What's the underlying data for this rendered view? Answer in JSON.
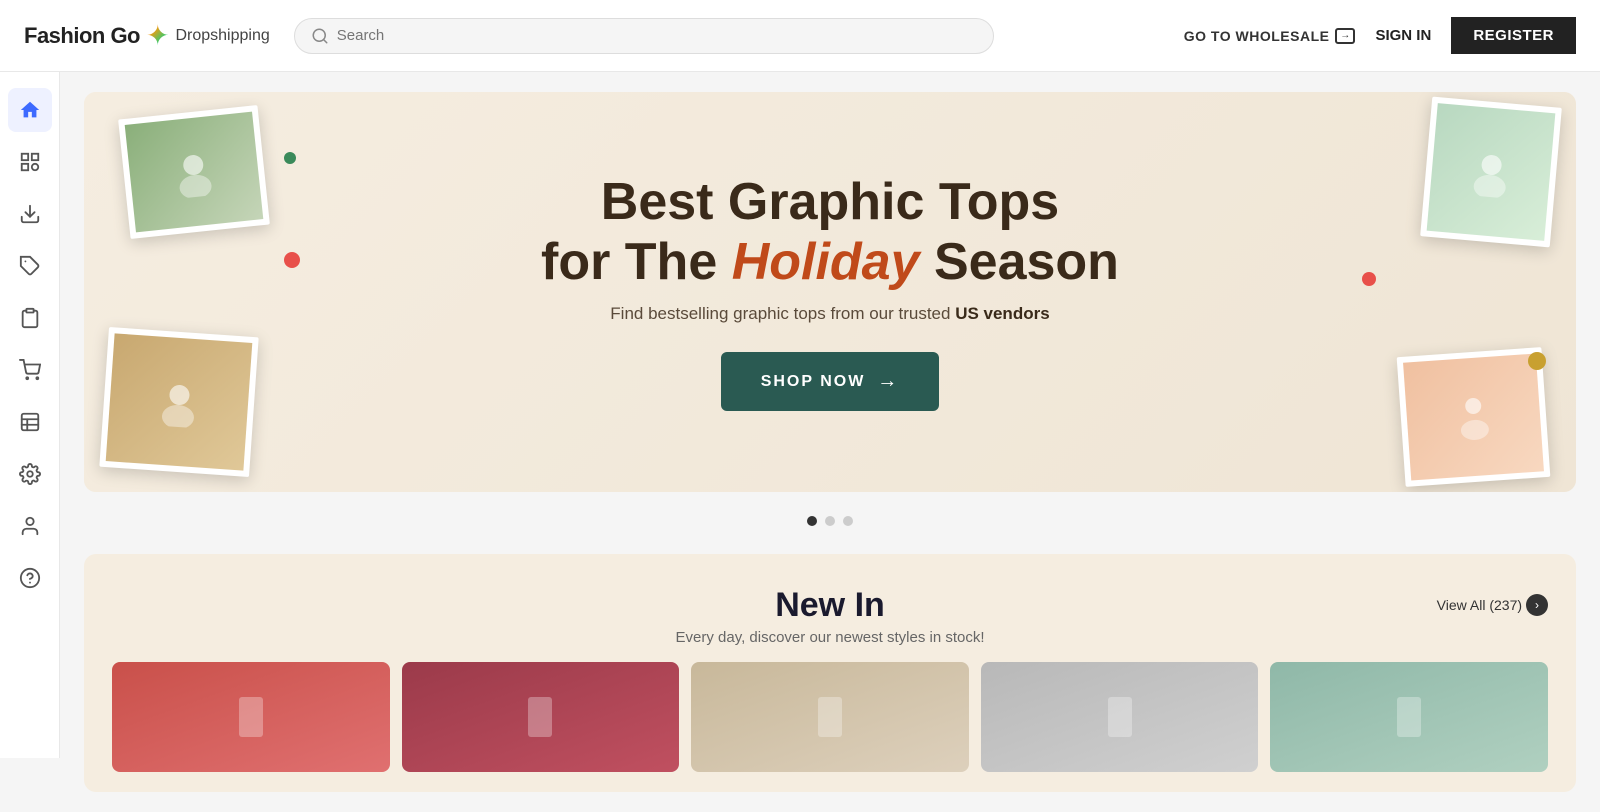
{
  "header": {
    "logo_brand": "Fashion Go",
    "logo_star_symbol": "✦",
    "logo_sub": "Dropshipping",
    "search_placeholder": "Search",
    "goto_wholesale_label": "GO TO WHOLESALE",
    "sign_in_label": "SIGN IN",
    "register_label": "REGISTER"
  },
  "sidebar": {
    "items": [
      {
        "id": "home",
        "icon": "home",
        "active": true
      },
      {
        "id": "search",
        "icon": "search",
        "active": false
      },
      {
        "id": "download",
        "icon": "download",
        "active": false
      },
      {
        "id": "tag",
        "icon": "tag",
        "active": false
      },
      {
        "id": "clipboard",
        "icon": "clipboard",
        "active": false
      },
      {
        "id": "cart",
        "icon": "cart",
        "active": false
      },
      {
        "id": "table",
        "icon": "table",
        "active": false
      },
      {
        "id": "settings",
        "icon": "settings",
        "active": false
      },
      {
        "id": "user",
        "icon": "user",
        "active": false
      },
      {
        "id": "help",
        "icon": "help",
        "active": false
      }
    ]
  },
  "banner": {
    "title_line1": "Best Graphic Tops",
    "title_line2_prefix": "for The ",
    "title_holiday": "Holiday",
    "title_line2_suffix": " Season",
    "subtitle": "Find bestselling graphic tops from our trusted ",
    "subtitle_bold": "US vendors",
    "shop_now_label": "SHOP NOW",
    "carousel_dots": [
      true,
      false,
      false
    ]
  },
  "new_in": {
    "title": "New In",
    "subtitle": "Every day, discover our newest styles in stock!",
    "view_all_label": "View All (237)",
    "products": [
      {
        "id": 1,
        "color": "red"
      },
      {
        "id": 2,
        "color": "dark-red"
      },
      {
        "id": 3,
        "color": "beige"
      },
      {
        "id": 4,
        "color": "gray"
      },
      {
        "id": 5,
        "color": "sage"
      }
    ]
  }
}
